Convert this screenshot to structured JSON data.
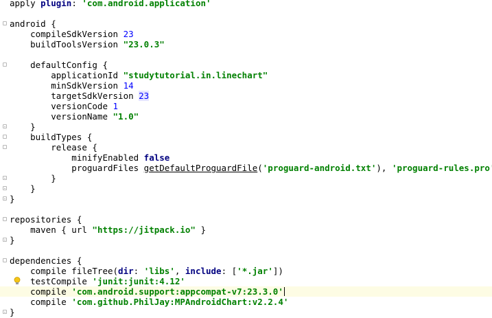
{
  "editor": {
    "lines": [
      [
        {
          "t": "apply ",
          "c": "plain"
        },
        {
          "t": "plugin",
          "c": "kw"
        },
        {
          "t": ": ",
          "c": "plain"
        },
        {
          "t": "'com.android.application'",
          "c": "str"
        }
      ],
      [],
      [
        {
          "t": "android {",
          "c": "plain"
        }
      ],
      [
        {
          "t": "    compileSdkVersion ",
          "c": "plain"
        },
        {
          "t": "23",
          "c": "num"
        }
      ],
      [
        {
          "t": "    buildToolsVersion ",
          "c": "plain"
        },
        {
          "t": "\"23.0.3\"",
          "c": "str"
        }
      ],
      [],
      [
        {
          "t": "    defaultConfig {",
          "c": "plain"
        }
      ],
      [
        {
          "t": "        applicationId ",
          "c": "plain"
        },
        {
          "t": "\"studytutorial.in.linechart\"",
          "c": "str"
        }
      ],
      [
        {
          "t": "        minSdkVersion ",
          "c": "plain"
        },
        {
          "t": "14",
          "c": "num"
        }
      ],
      [
        {
          "t": "        targetSdkVersion ",
          "c": "plain"
        },
        {
          "t": "23",
          "c": "num hl-num"
        }
      ],
      [
        {
          "t": "        versionCode ",
          "c": "plain"
        },
        {
          "t": "1",
          "c": "num"
        }
      ],
      [
        {
          "t": "        versionName ",
          "c": "plain"
        },
        {
          "t": "\"1.0\"",
          "c": "str"
        }
      ],
      [
        {
          "t": "    }",
          "c": "plain"
        }
      ],
      [
        {
          "t": "    buildTypes {",
          "c": "plain"
        }
      ],
      [
        {
          "t": "        release {",
          "c": "plain"
        }
      ],
      [
        {
          "t": "            minifyEnabled ",
          "c": "plain"
        },
        {
          "t": "false",
          "c": "kw"
        }
      ],
      [
        {
          "t": "            proguardFiles ",
          "c": "plain"
        },
        {
          "t": "getDefaultProguardFile",
          "c": "fn"
        },
        {
          "t": "(",
          "c": "plain"
        },
        {
          "t": "'proguard-android.txt'",
          "c": "str"
        },
        {
          "t": "), ",
          "c": "plain"
        },
        {
          "t": "'proguard-rules.pro'",
          "c": "str"
        }
      ],
      [
        {
          "t": "        }",
          "c": "plain"
        }
      ],
      [
        {
          "t": "    }",
          "c": "plain"
        }
      ],
      [
        {
          "t": "}",
          "c": "plain"
        }
      ],
      [],
      [
        {
          "t": "repositories {",
          "c": "plain"
        }
      ],
      [
        {
          "t": "    maven { url ",
          "c": "plain"
        },
        {
          "t": "\"https://jitpack.io\"",
          "c": "str"
        },
        {
          "t": " }",
          "c": "plain"
        }
      ],
      [
        {
          "t": "}",
          "c": "plain"
        }
      ],
      [],
      [
        {
          "t": "dependencies {",
          "c": "plain"
        }
      ],
      [
        {
          "t": "    compile fileTree(",
          "c": "plain"
        },
        {
          "t": "dir",
          "c": "kw"
        },
        {
          "t": ": ",
          "c": "plain"
        },
        {
          "t": "'libs'",
          "c": "str"
        },
        {
          "t": ", ",
          "c": "plain"
        },
        {
          "t": "include",
          "c": "kw"
        },
        {
          "t": ": [",
          "c": "plain"
        },
        {
          "t": "'*.jar'",
          "c": "str"
        },
        {
          "t": "])",
          "c": "plain"
        }
      ],
      [
        {
          "t": "    testCompile ",
          "c": "plain"
        },
        {
          "t": "'junit:junit:4.12'",
          "c": "str"
        }
      ],
      [
        {
          "t": "    compile ",
          "c": "plain"
        },
        {
          "t": "'com.android.support:appcompat-v7:23.3.0'",
          "c": "str"
        }
      ],
      [
        {
          "t": "    compile ",
          "c": "plain"
        },
        {
          "t": "'com.github.PhilJay:MPAndroidChart:v2.2.4'",
          "c": "str"
        }
      ],
      [
        {
          "t": "}",
          "c": "plain"
        }
      ]
    ],
    "current_line": 28,
    "caret_after_line": 28,
    "intention_bulb_line": 27,
    "fold_open_lines": [
      2,
      6,
      13,
      14,
      21,
      25
    ],
    "fold_close_lines": [
      12,
      17,
      18,
      19,
      23,
      30
    ],
    "colors": {
      "keyword": "#000080",
      "string": "#008000",
      "number": "#0000ff",
      "current_line_bg": "#fdfce4",
      "bulb": "#f5c518"
    },
    "bulb_icon": "lightbulb-icon"
  }
}
